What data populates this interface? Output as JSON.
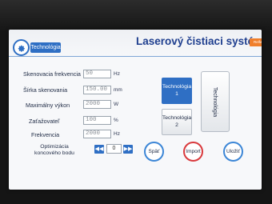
{
  "colors": {
    "accent_blue": "#2f6fc4",
    "title_blue": "#1f3f8f",
    "brand_orange": "#f07f2c",
    "back_ring": "#3c86d6",
    "import_ring": "#d9393c",
    "save_ring": "#3c86d6"
  },
  "header": {
    "tab_label": "Technológia",
    "title": "Laserový čistiaci systém",
    "brand_tag": "Relfar",
    "tab_icon": "gear-icon"
  },
  "params": [
    {
      "label": "Skenovacia frekvencia",
      "value": "50",
      "unit": "Hz"
    },
    {
      "label": "Šírka skenovania",
      "value": "150.00",
      "unit": "mm"
    },
    {
      "label": "Maximálny výkon",
      "value": "2000",
      "unit": "W"
    },
    {
      "label": "Zaťažovateľ",
      "value": "100",
      "unit": "%"
    },
    {
      "label": "Frekvencia",
      "value": "2000",
      "unit": "Hz"
    }
  ],
  "optimization": {
    "label": "Optimizácia koncového bodu",
    "value": "0",
    "prev_icon": "double-left-icon",
    "next_icon": "double-right-icon"
  },
  "tech_buttons": {
    "tech1_line1": "Technológia",
    "tech1_line2": "1",
    "tech2_line1": "Technológia",
    "tech2_line2": "2",
    "tall_label": "Technológia"
  },
  "actions": {
    "back": "Späť",
    "import": "Import",
    "save": "Uložiť"
  }
}
